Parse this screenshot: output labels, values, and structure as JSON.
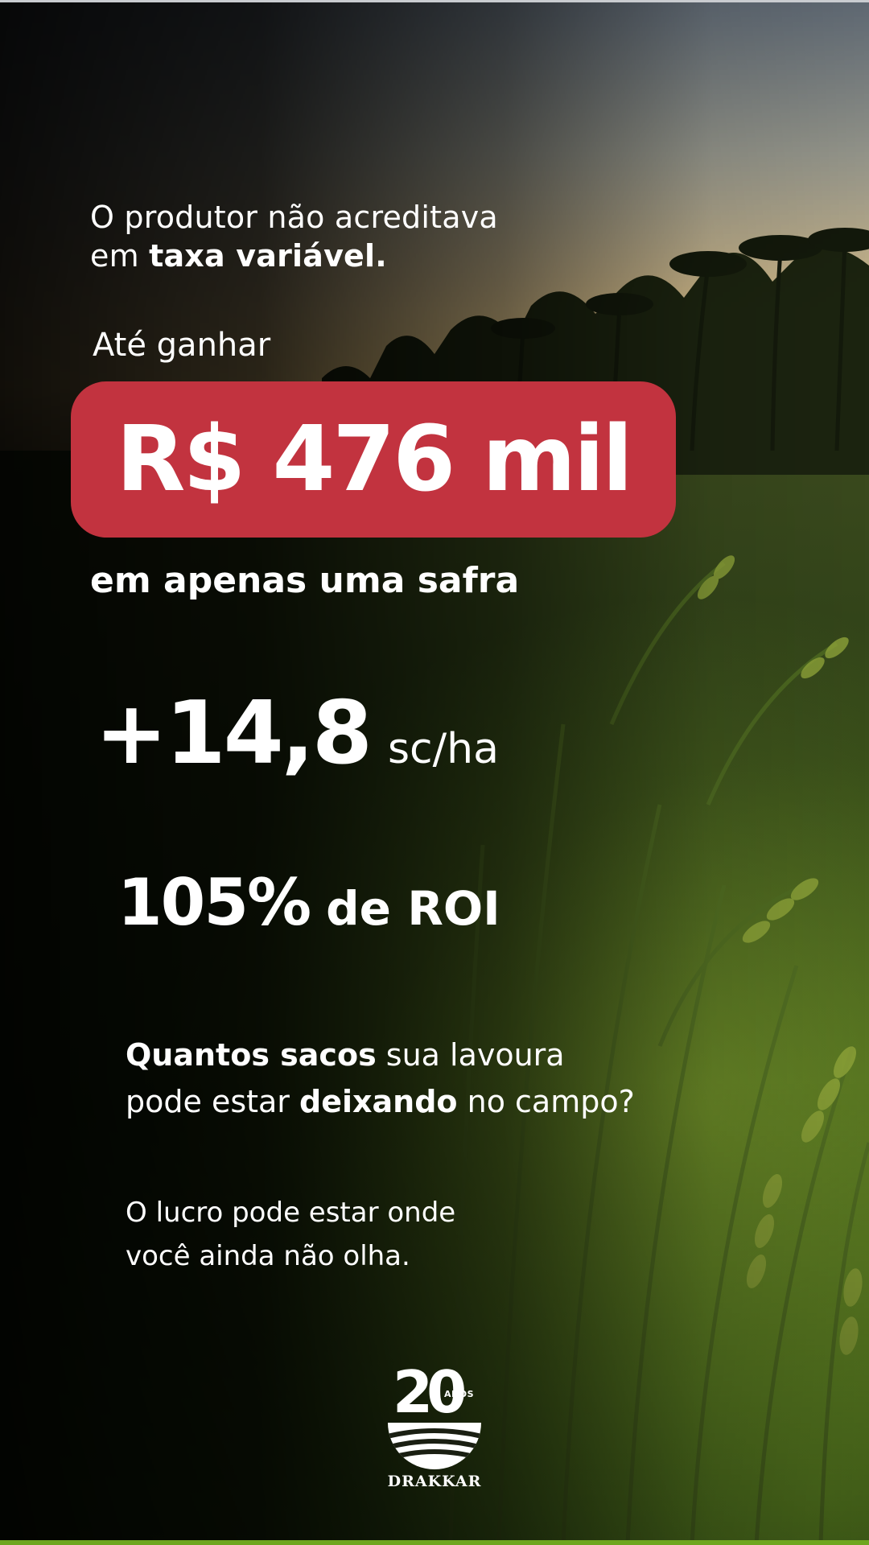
{
  "headline": {
    "line1": "O produtor não acreditava",
    "line2_prefix": "em ",
    "line2_bold": "taxa variável."
  },
  "lead_in": "Até ganhar",
  "highlight_amount": "R$ 476 mil",
  "harvest_note": "em apenas uma safra",
  "yield": {
    "value": "+14,8",
    "unit": "sc/ha"
  },
  "roi": {
    "value": "105%",
    "label": "de ROI"
  },
  "question": {
    "bold1": "Quantos sacos",
    "text1": " sua lavoura",
    "text2": "pode estar ",
    "bold2": "deixando",
    "text3": " no campo?"
  },
  "closing": {
    "line1": "O lucro pode estar onde",
    "line2": "você ainda não olha."
  },
  "logo": {
    "number": "20",
    "anos": "ANOS",
    "brand": "DRAKKAR"
  },
  "colors": {
    "highlight_pill": "#c2333f",
    "text": "#ffffff"
  },
  "icons": [
    "drakkar-field-emblem-icon"
  ]
}
